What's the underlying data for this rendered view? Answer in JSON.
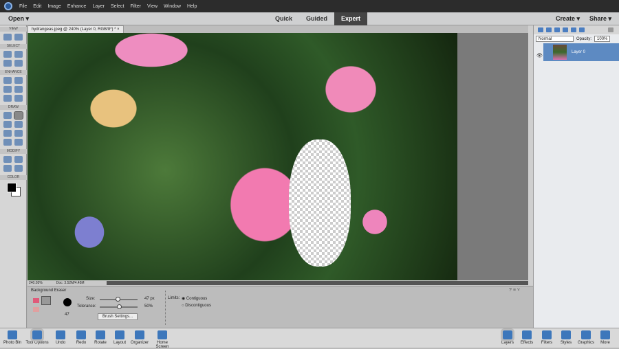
{
  "menu": [
    "File",
    "Edit",
    "Image",
    "Enhance",
    "Layer",
    "Select",
    "Filter",
    "View",
    "Window",
    "Help"
  ],
  "modebar": {
    "open": "Open ▾",
    "modes": [
      "Quick",
      "Guided",
      "Expert"
    ],
    "selected_mode": "Expert",
    "create": "Create ▾",
    "share": "Share ▾"
  },
  "document_tab": {
    "title": "hydrangeas.jpeg @ 240% (Layer 0, RGB/8*) *",
    "close": "×"
  },
  "toolbox": {
    "sections": [
      "VIEW",
      "SELECT",
      "ENHANCE",
      "DRAW",
      "MODIFY",
      "COLOR"
    ]
  },
  "status": {
    "zoom": "240.03%",
    "doc": "Doc: 3.52M/4.45M"
  },
  "tool_options": {
    "tool_name": "Background Eraser",
    "brush_size_preview": "47",
    "size_label": "Size:",
    "size_value": "47 px",
    "size_fraction": 0.47,
    "tolerance_label": "Tolerance:",
    "tolerance_value": "50%",
    "tolerance_fraction": 0.5,
    "brush_settings": "Brush Settings...",
    "limits_label": "Limits:",
    "contiguous": "Contiguous",
    "discontiguous": "Discontiguous",
    "selected_limit": "Contiguous"
  },
  "layers_panel": {
    "blend_mode": "Normal",
    "opacity_label": "Opacity:",
    "opacity_value": "100%",
    "layers": [
      {
        "name": "Layer 0",
        "visible": true
      }
    ]
  },
  "taskbar_left": [
    "Photo Bin",
    "Tool Options",
    "Undo",
    "Redo",
    "Rotate",
    "Layout",
    "Organizer",
    "Home Screen"
  ],
  "taskbar_right": [
    "Layers",
    "Effects",
    "Filters",
    "Styles",
    "Graphics",
    "More"
  ],
  "colors": {
    "accent": "#5d8ac2",
    "menubar": "#2c2c2c",
    "selected_mode": "#444444"
  }
}
